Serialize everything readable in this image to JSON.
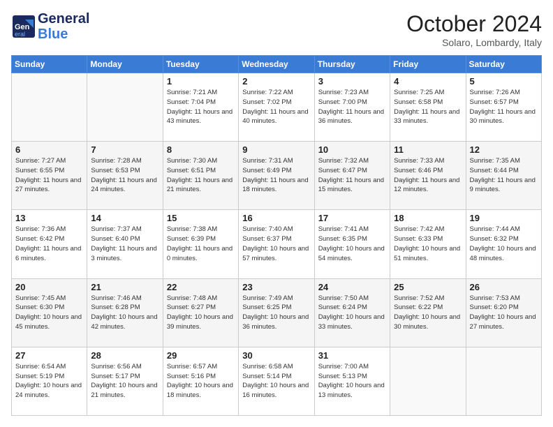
{
  "header": {
    "logo_line1": "General",
    "logo_line2": "Blue",
    "month": "October 2024",
    "location": "Solaro, Lombardy, Italy"
  },
  "weekdays": [
    "Sunday",
    "Monday",
    "Tuesday",
    "Wednesday",
    "Thursday",
    "Friday",
    "Saturday"
  ],
  "weeks": [
    [
      {
        "day": "",
        "info": ""
      },
      {
        "day": "",
        "info": ""
      },
      {
        "day": "1",
        "info": "Sunrise: 7:21 AM\nSunset: 7:04 PM\nDaylight: 11 hours and 43 minutes."
      },
      {
        "day": "2",
        "info": "Sunrise: 7:22 AM\nSunset: 7:02 PM\nDaylight: 11 hours and 40 minutes."
      },
      {
        "day": "3",
        "info": "Sunrise: 7:23 AM\nSunset: 7:00 PM\nDaylight: 11 hours and 36 minutes."
      },
      {
        "day": "4",
        "info": "Sunrise: 7:25 AM\nSunset: 6:58 PM\nDaylight: 11 hours and 33 minutes."
      },
      {
        "day": "5",
        "info": "Sunrise: 7:26 AM\nSunset: 6:57 PM\nDaylight: 11 hours and 30 minutes."
      }
    ],
    [
      {
        "day": "6",
        "info": "Sunrise: 7:27 AM\nSunset: 6:55 PM\nDaylight: 11 hours and 27 minutes."
      },
      {
        "day": "7",
        "info": "Sunrise: 7:28 AM\nSunset: 6:53 PM\nDaylight: 11 hours and 24 minutes."
      },
      {
        "day": "8",
        "info": "Sunrise: 7:30 AM\nSunset: 6:51 PM\nDaylight: 11 hours and 21 minutes."
      },
      {
        "day": "9",
        "info": "Sunrise: 7:31 AM\nSunset: 6:49 PM\nDaylight: 11 hours and 18 minutes."
      },
      {
        "day": "10",
        "info": "Sunrise: 7:32 AM\nSunset: 6:47 PM\nDaylight: 11 hours and 15 minutes."
      },
      {
        "day": "11",
        "info": "Sunrise: 7:33 AM\nSunset: 6:46 PM\nDaylight: 11 hours and 12 minutes."
      },
      {
        "day": "12",
        "info": "Sunrise: 7:35 AM\nSunset: 6:44 PM\nDaylight: 11 hours and 9 minutes."
      }
    ],
    [
      {
        "day": "13",
        "info": "Sunrise: 7:36 AM\nSunset: 6:42 PM\nDaylight: 11 hours and 6 minutes."
      },
      {
        "day": "14",
        "info": "Sunrise: 7:37 AM\nSunset: 6:40 PM\nDaylight: 11 hours and 3 minutes."
      },
      {
        "day": "15",
        "info": "Sunrise: 7:38 AM\nSunset: 6:39 PM\nDaylight: 11 hours and 0 minutes."
      },
      {
        "day": "16",
        "info": "Sunrise: 7:40 AM\nSunset: 6:37 PM\nDaylight: 10 hours and 57 minutes."
      },
      {
        "day": "17",
        "info": "Sunrise: 7:41 AM\nSunset: 6:35 PM\nDaylight: 10 hours and 54 minutes."
      },
      {
        "day": "18",
        "info": "Sunrise: 7:42 AM\nSunset: 6:33 PM\nDaylight: 10 hours and 51 minutes."
      },
      {
        "day": "19",
        "info": "Sunrise: 7:44 AM\nSunset: 6:32 PM\nDaylight: 10 hours and 48 minutes."
      }
    ],
    [
      {
        "day": "20",
        "info": "Sunrise: 7:45 AM\nSunset: 6:30 PM\nDaylight: 10 hours and 45 minutes."
      },
      {
        "day": "21",
        "info": "Sunrise: 7:46 AM\nSunset: 6:28 PM\nDaylight: 10 hours and 42 minutes."
      },
      {
        "day": "22",
        "info": "Sunrise: 7:48 AM\nSunset: 6:27 PM\nDaylight: 10 hours and 39 minutes."
      },
      {
        "day": "23",
        "info": "Sunrise: 7:49 AM\nSunset: 6:25 PM\nDaylight: 10 hours and 36 minutes."
      },
      {
        "day": "24",
        "info": "Sunrise: 7:50 AM\nSunset: 6:24 PM\nDaylight: 10 hours and 33 minutes."
      },
      {
        "day": "25",
        "info": "Sunrise: 7:52 AM\nSunset: 6:22 PM\nDaylight: 10 hours and 30 minutes."
      },
      {
        "day": "26",
        "info": "Sunrise: 7:53 AM\nSunset: 6:20 PM\nDaylight: 10 hours and 27 minutes."
      }
    ],
    [
      {
        "day": "27",
        "info": "Sunrise: 6:54 AM\nSunset: 5:19 PM\nDaylight: 10 hours and 24 minutes."
      },
      {
        "day": "28",
        "info": "Sunrise: 6:56 AM\nSunset: 5:17 PM\nDaylight: 10 hours and 21 minutes."
      },
      {
        "day": "29",
        "info": "Sunrise: 6:57 AM\nSunset: 5:16 PM\nDaylight: 10 hours and 18 minutes."
      },
      {
        "day": "30",
        "info": "Sunrise: 6:58 AM\nSunset: 5:14 PM\nDaylight: 10 hours and 16 minutes."
      },
      {
        "day": "31",
        "info": "Sunrise: 7:00 AM\nSunset: 5:13 PM\nDaylight: 10 hours and 13 minutes."
      },
      {
        "day": "",
        "info": ""
      },
      {
        "day": "",
        "info": ""
      }
    ]
  ]
}
